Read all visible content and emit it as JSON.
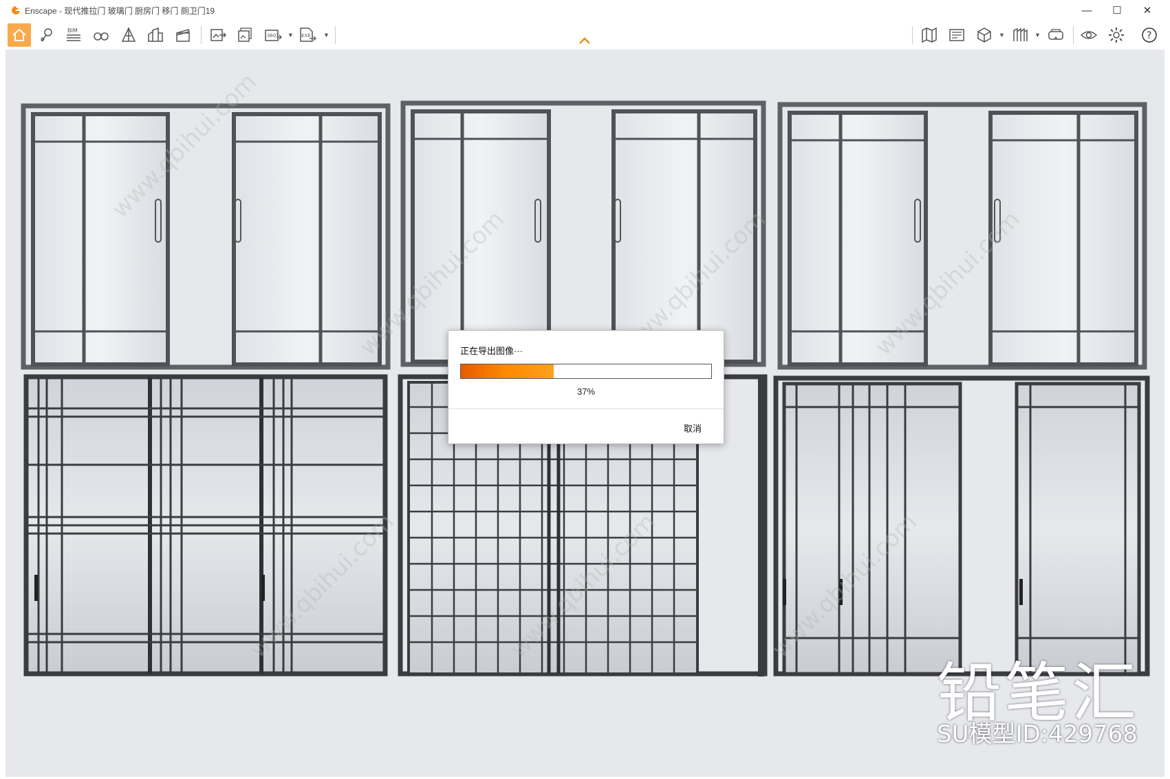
{
  "window": {
    "title": "Enscape - 现代推拉门 玻璃门 厨房门 移门 厕卫门19",
    "minimize": "—",
    "maximize": "☐",
    "close": "✕"
  },
  "toolbar": {
    "left_icons": [
      "home-icon",
      "location-pin-icon",
      "bim-icon",
      "binoculars-icon",
      "perspective-icon",
      "buildings-icon",
      "clapperboard-icon"
    ],
    "export_icons": [
      "export-image-icon",
      "batch-export-icon",
      "export-360-icon",
      "export-exe-icon"
    ],
    "right_icons": [
      "map-icon",
      "asset-library-icon",
      "cube-view-icon",
      "material-icon",
      "vr-headset-icon",
      "visibility-eye-icon",
      "settings-gear-icon",
      "help-icon"
    ],
    "bim_label": "BIM",
    "pano_label": "360°",
    "exe_label": "EXE",
    "help_label": "?",
    "accent": "#f9a94a"
  },
  "dialog": {
    "title": "正在导出图像···",
    "progress": 0.37,
    "progress_label": "37%",
    "cancel_label": "取消"
  },
  "overlay": {
    "brand": "铅笔汇",
    "model_id": "SU模型ID:429768",
    "watermark": "www.qbihui.com"
  }
}
